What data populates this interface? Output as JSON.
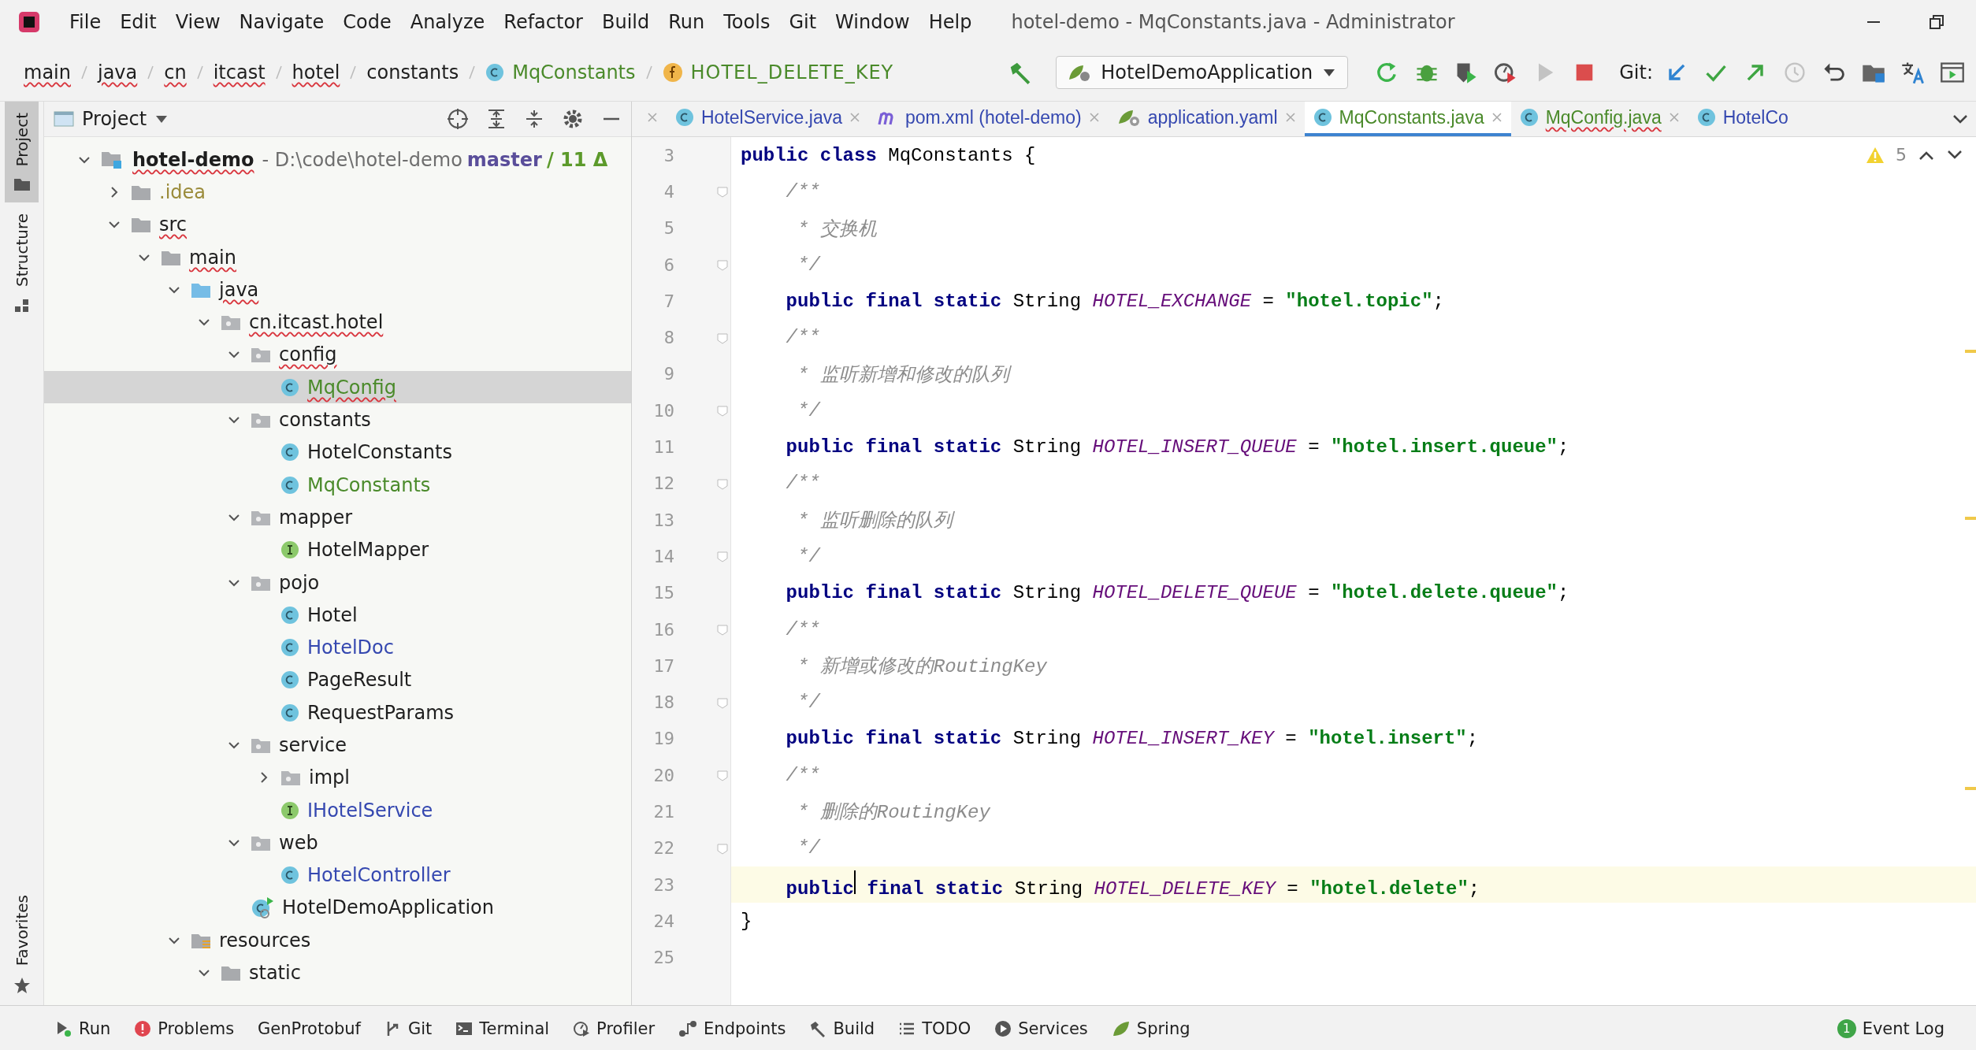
{
  "window": {
    "title": "hotel-demo - MqConstants.java - Administrator"
  },
  "menu": [
    "File",
    "Edit",
    "View",
    "Navigate",
    "Code",
    "Analyze",
    "Refactor",
    "Build",
    "Run",
    "Tools",
    "Git",
    "Window",
    "Help"
  ],
  "breadcrumb": [
    {
      "text": "main",
      "kind": "folder",
      "typo": true
    },
    {
      "text": "java",
      "kind": "folder",
      "typo": true
    },
    {
      "text": "cn",
      "kind": "folder",
      "typo": true
    },
    {
      "text": "itcast",
      "kind": "folder",
      "typo": true
    },
    {
      "text": "hotel",
      "kind": "folder",
      "typo": true
    },
    {
      "text": "constants",
      "kind": "folder",
      "typo": false
    },
    {
      "text": "MqConstants",
      "kind": "class",
      "typo": false
    },
    {
      "text": "HOTEL_DELETE_KEY",
      "kind": "field",
      "typo": false
    }
  ],
  "run_config": "HotelDemoApplication",
  "toolbar": [
    {
      "kind": "rerun",
      "disabled": false
    },
    {
      "kind": "debug",
      "disabled": false
    },
    {
      "kind": "coverage",
      "disabled": false
    },
    {
      "kind": "profile",
      "disabled": false
    },
    {
      "kind": "run",
      "disabled": true
    },
    {
      "kind": "stop",
      "disabled": false
    }
  ],
  "git_label": "Git:",
  "git_tools": [
    {
      "kind": "update",
      "disabled": false
    },
    {
      "kind": "commit",
      "disabled": false
    },
    {
      "kind": "push",
      "disabled": false
    },
    {
      "kind": "history",
      "disabled": true
    },
    {
      "kind": "rollback",
      "disabled": false
    }
  ],
  "side_tabs": [
    {
      "label": "Project",
      "selected": true,
      "kind": "project"
    },
    {
      "label": "Structure",
      "selected": false,
      "kind": "structure"
    },
    {
      "label": "Favorites",
      "selected": false,
      "kind": "favorites"
    }
  ],
  "project_panel": {
    "title": "Project",
    "root": {
      "name": "hotel-demo",
      "path": "- D:\\code\\hotel-demo",
      "branch": "master",
      "changes": "/ 11 Δ",
      "expanded": true,
      "typo": true
    },
    "tree": [
      {
        "name": ".idea",
        "kind": "folder",
        "expanded": false,
        "selected": false,
        "color": "#9a8b3a",
        "typo": false
      },
      {
        "name": "src",
        "kind": "folder",
        "expanded": true,
        "selected": false,
        "color": "#1e1e1e",
        "typo": true,
        "children": [
          {
            "name": "main",
            "kind": "folder",
            "expanded": true,
            "selected": false,
            "color": "#1e1e1e",
            "typo": true,
            "children": [
              {
                "name": "java",
                "kind": "source",
                "expanded": true,
                "selected": false,
                "color": "#1e1e1e",
                "typo": true,
                "children": [
                  {
                    "name": "cn.itcast.hotel",
                    "kind": "package",
                    "expanded": true,
                    "selected": false,
                    "color": "#1e1e1e",
                    "typo": true,
                    "children": [
                      {
                        "name": "config",
                        "kind": "package",
                        "expanded": true,
                        "selected": false,
                        "color": "#1e1e1e",
                        "typo": true,
                        "children": [
                          {
                            "name": "MqConfig",
                            "kind": "class",
                            "selected": true,
                            "color": "#4a8a2a",
                            "typo": true
                          }
                        ]
                      },
                      {
                        "name": "constants",
                        "kind": "package",
                        "expanded": true,
                        "selected": false,
                        "color": "#1e1e1e",
                        "typo": false,
                        "children": [
                          {
                            "name": "HotelConstants",
                            "kind": "class",
                            "selected": false,
                            "color": "#1e1e1e",
                            "typo": false
                          },
                          {
                            "name": "MqConstants",
                            "kind": "class",
                            "selected": false,
                            "color": "#4a8a2a",
                            "typo": false
                          }
                        ]
                      },
                      {
                        "name": "mapper",
                        "kind": "package",
                        "expanded": true,
                        "selected": false,
                        "color": "#1e1e1e",
                        "typo": false,
                        "children": [
                          {
                            "name": "HotelMapper",
                            "kind": "interface",
                            "selected": false,
                            "color": "#1e1e1e",
                            "typo": false
                          }
                        ]
                      },
                      {
                        "name": "pojo",
                        "kind": "package",
                        "expanded": true,
                        "selected": false,
                        "color": "#1e1e1e",
                        "typo": false,
                        "children": [
                          {
                            "name": "Hotel",
                            "kind": "class",
                            "selected": false,
                            "color": "#1e1e1e",
                            "typo": false
                          },
                          {
                            "name": "HotelDoc",
                            "kind": "class",
                            "selected": false,
                            "color": "#3548b0",
                            "typo": false
                          },
                          {
                            "name": "PageResult",
                            "kind": "class",
                            "selected": false,
                            "color": "#1e1e1e",
                            "typo": false
                          },
                          {
                            "name": "RequestParams",
                            "kind": "class",
                            "selected": false,
                            "color": "#1e1e1e",
                            "typo": false
                          }
                        ]
                      },
                      {
                        "name": "service",
                        "kind": "package",
                        "expanded": true,
                        "selected": false,
                        "color": "#1e1e1e",
                        "typo": false,
                        "children": [
                          {
                            "name": "impl",
                            "kind": "package",
                            "expanded": false,
                            "selected": false,
                            "color": "#1e1e1e",
                            "typo": false
                          },
                          {
                            "name": "IHotelService",
                            "kind": "interface",
                            "selected": false,
                            "color": "#3548b0",
                            "typo": false
                          }
                        ]
                      },
                      {
                        "name": "web",
                        "kind": "package",
                        "expanded": true,
                        "selected": false,
                        "color": "#1e1e1e",
                        "typo": false,
                        "children": [
                          {
                            "name": "HotelController",
                            "kind": "class",
                            "selected": false,
                            "color": "#3548b0",
                            "typo": false
                          }
                        ]
                      },
                      {
                        "name": "HotelDemoApplication",
                        "kind": "app",
                        "selected": false,
                        "color": "#1e1e1e",
                        "typo": false
                      }
                    ]
                  }
                ]
              },
              {
                "name": "resources",
                "kind": "resources",
                "expanded": true,
                "selected": false,
                "color": "#1e1e1e",
                "typo": false,
                "children": [
                  {
                    "name": "static",
                    "kind": "folder",
                    "expanded": true,
                    "selected": false,
                    "color": "#1e1e1e",
                    "typo": false
                  }
                ]
              }
            ]
          }
        ]
      }
    ]
  },
  "editor_tabs": [
    {
      "label": "HotelService.java",
      "kind": "class",
      "selected": false,
      "color": "#3548b0",
      "typo": false
    },
    {
      "label": "pom.xml (hotel-demo)",
      "kind": "maven",
      "selected": false,
      "color": "#3548b0",
      "typo": false
    },
    {
      "label": "application.yaml",
      "kind": "yaml",
      "selected": false,
      "color": "#3548b0",
      "typo": false
    },
    {
      "label": "MqConstants.java",
      "kind": "class",
      "selected": true,
      "color": "#4a8a2a",
      "typo": false
    },
    {
      "label": "MqConfig.java",
      "kind": "class",
      "selected": false,
      "color": "#4a8a2a",
      "typo": true
    },
    {
      "label": "HotelCo",
      "kind": "class",
      "selected": false,
      "color": "#3548b0",
      "typo": false
    }
  ],
  "inspections": {
    "warnings": "5"
  },
  "code": [
    {
      "number": "3",
      "fold": false,
      "current": false,
      "tokens": [
        {
          "kind": "kw",
          "text": "public class "
        },
        {
          "kind": "plain",
          "text": "MqConstants {"
        }
      ]
    },
    {
      "number": "4",
      "fold": true,
      "current": false,
      "tokens": [
        {
          "kind": "comment",
          "text": "    /**"
        }
      ]
    },
    {
      "number": "5",
      "fold": false,
      "current": false,
      "tokens": [
        {
          "kind": "comment",
          "text": "     * 交换机"
        }
      ]
    },
    {
      "number": "6",
      "fold": true,
      "current": false,
      "tokens": [
        {
          "kind": "comment",
          "text": "     */"
        }
      ]
    },
    {
      "number": "7",
      "fold": false,
      "current": false,
      "tokens": [
        {
          "kind": "kw",
          "text": "    public final static "
        },
        {
          "kind": "plain",
          "text": "String "
        },
        {
          "kind": "const",
          "text": "HOTEL_EXCHANGE"
        },
        {
          "kind": "plain",
          "text": " = "
        },
        {
          "kind": "string",
          "text": "\"hotel.topic\""
        },
        {
          "kind": "plain",
          "text": ";"
        }
      ]
    },
    {
      "number": "8",
      "fold": true,
      "current": false,
      "tokens": [
        {
          "kind": "comment",
          "text": "    /**"
        }
      ]
    },
    {
      "number": "9",
      "fold": false,
      "current": false,
      "tokens": [
        {
          "kind": "comment",
          "text": "     * 监听新增和修改的队列"
        }
      ]
    },
    {
      "number": "10",
      "fold": true,
      "current": false,
      "tokens": [
        {
          "kind": "comment",
          "text": "     */"
        }
      ]
    },
    {
      "number": "11",
      "fold": false,
      "current": false,
      "tokens": [
        {
          "kind": "kw",
          "text": "    public final static "
        },
        {
          "kind": "plain",
          "text": "String "
        },
        {
          "kind": "const",
          "text": "HOTEL_INSERT_QUEUE"
        },
        {
          "kind": "plain",
          "text": " = "
        },
        {
          "kind": "string",
          "text": "\"hotel.insert.queue\""
        },
        {
          "kind": "plain",
          "text": ";"
        }
      ]
    },
    {
      "number": "12",
      "fold": true,
      "current": false,
      "tokens": [
        {
          "kind": "comment",
          "text": "    /**"
        }
      ]
    },
    {
      "number": "13",
      "fold": false,
      "current": false,
      "tokens": [
        {
          "kind": "comment",
          "text": "     * 监听删除的队列"
        }
      ]
    },
    {
      "number": "14",
      "fold": true,
      "current": false,
      "tokens": [
        {
          "kind": "comment",
          "text": "     */"
        }
      ]
    },
    {
      "number": "15",
      "fold": false,
      "current": false,
      "tokens": [
        {
          "kind": "kw",
          "text": "    public final static "
        },
        {
          "kind": "plain",
          "text": "String "
        },
        {
          "kind": "const",
          "text": "HOTEL_DELETE_QUEUE"
        },
        {
          "kind": "plain",
          "text": " = "
        },
        {
          "kind": "string",
          "text": "\"hotel.delete.queue\""
        },
        {
          "kind": "plain",
          "text": ";"
        }
      ]
    },
    {
      "number": "16",
      "fold": true,
      "current": false,
      "tokens": [
        {
          "kind": "comment",
          "text": "    /**"
        }
      ]
    },
    {
      "number": "17",
      "fold": false,
      "current": false,
      "tokens": [
        {
          "kind": "comment",
          "text": "     * 新增或修改的RoutingKey"
        }
      ]
    },
    {
      "number": "18",
      "fold": true,
      "current": false,
      "tokens": [
        {
          "kind": "comment",
          "text": "     */"
        }
      ]
    },
    {
      "number": "19",
      "fold": false,
      "current": false,
      "tokens": [
        {
          "kind": "kw",
          "text": "    public final static "
        },
        {
          "kind": "plain",
          "text": "String "
        },
        {
          "kind": "const",
          "text": "HOTEL_INSERT_KEY"
        },
        {
          "kind": "plain",
          "text": " = "
        },
        {
          "kind": "string",
          "text": "\"hotel.insert\""
        },
        {
          "kind": "plain",
          "text": ";"
        }
      ]
    },
    {
      "number": "20",
      "fold": true,
      "current": false,
      "tokens": [
        {
          "kind": "comment",
          "text": "    /**"
        }
      ]
    },
    {
      "number": "21",
      "fold": false,
      "current": false,
      "tokens": [
        {
          "kind": "comment",
          "text": "     * 删除的RoutingKey"
        }
      ]
    },
    {
      "number": "22",
      "fold": true,
      "current": false,
      "tokens": [
        {
          "kind": "comment",
          "text": "     */"
        }
      ]
    },
    {
      "number": "23",
      "fold": false,
      "current": true,
      "tokens": [
        {
          "kind": "kw",
          "text": "    public",
          "caret_after": true
        },
        {
          "kind": "kw",
          "text": " final static "
        },
        {
          "kind": "plain",
          "text": "String "
        },
        {
          "kind": "const",
          "text": "HOTEL_DELETE_KEY"
        },
        {
          "kind": "plain",
          "text": " = "
        },
        {
          "kind": "string",
          "text": "\"hotel.delete\""
        },
        {
          "kind": "plain",
          "text": ";"
        }
      ]
    },
    {
      "number": "24",
      "fold": false,
      "current": false,
      "tokens": [
        {
          "kind": "plain",
          "text": "}"
        }
      ]
    },
    {
      "number": "25",
      "fold": false,
      "current": false
    }
  ],
  "tool_windows": [
    {
      "label": "Run",
      "kind": "run"
    },
    {
      "label": "Problems",
      "kind": "problems"
    },
    {
      "label": "GenProtobuf",
      "kind": "none"
    },
    {
      "label": "Git",
      "kind": "git"
    },
    {
      "label": "Terminal",
      "kind": "terminal"
    },
    {
      "label": "Profiler",
      "kind": "profiler"
    },
    {
      "label": "Endpoints",
      "kind": "endpoints"
    },
    {
      "label": "Build",
      "kind": "build"
    },
    {
      "label": "TODO",
      "kind": "todo"
    },
    {
      "label": "Services",
      "kind": "services"
    },
    {
      "label": "Spring",
      "kind": "spring"
    }
  ],
  "event_log": {
    "label": "Event Log",
    "count": "1"
  }
}
